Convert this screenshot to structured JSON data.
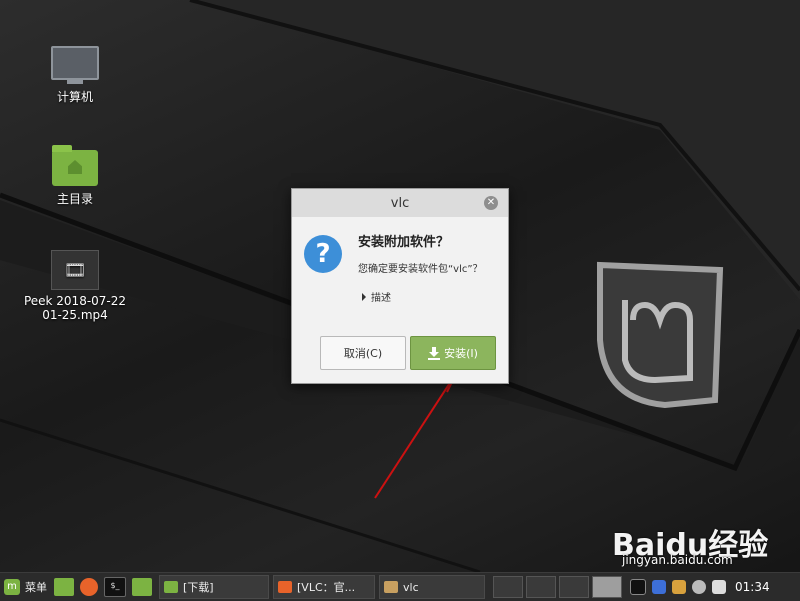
{
  "desktop": {
    "icons": [
      {
        "label": "计算机"
      },
      {
        "label": "主目录"
      },
      {
        "label": "Peek 2018-07-22\n01-25.mp4"
      }
    ]
  },
  "dialog": {
    "title": "vlc",
    "heading": "安装附加软件？",
    "message": "您确定要安装软件包“vlc”？",
    "details_label": "描述",
    "cancel_label": "取消(C)",
    "install_label": "安装(I)"
  },
  "taskbar": {
    "menu_label": "菜单",
    "windows": [
      {
        "label": "[下载]"
      },
      {
        "label": "[VLC：官..."
      },
      {
        "label": "vlc"
      }
    ],
    "clock": "01:34"
  },
  "watermark": {
    "brand": "Baidu经验",
    "url": "jingyan.baidu.com"
  },
  "colors": {
    "accent_green": "#8cb55d",
    "question_blue": "#3d8fd8",
    "annotation_red": "#cc1111"
  }
}
